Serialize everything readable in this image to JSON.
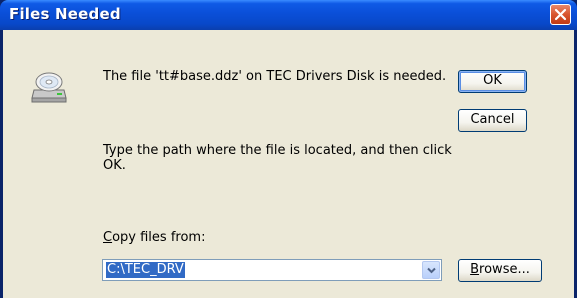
{
  "window": {
    "title": "Files Needed"
  },
  "message": {
    "line1": "The file 'tt#base.ddz' on TEC Drivers Disk is needed.",
    "line2": "Type the path where the file is located, and then click OK."
  },
  "buttons": {
    "ok": "OK",
    "cancel": "Cancel",
    "browse_first": "B",
    "browse_rest": "rowse..."
  },
  "copy_from": {
    "label_first": "C",
    "label_rest": "opy files from:",
    "value": "C:\\TEC_DRV"
  },
  "icons": {
    "dialog_icon": "cd-drive-icon",
    "close": "close-icon",
    "dropdown": "chevron-down-icon"
  },
  "colors": {
    "title_bar": "#0a4fd8",
    "close_button": "#d8552e",
    "selection": "#316ac5",
    "dialog_bg": "#ece9d8"
  }
}
